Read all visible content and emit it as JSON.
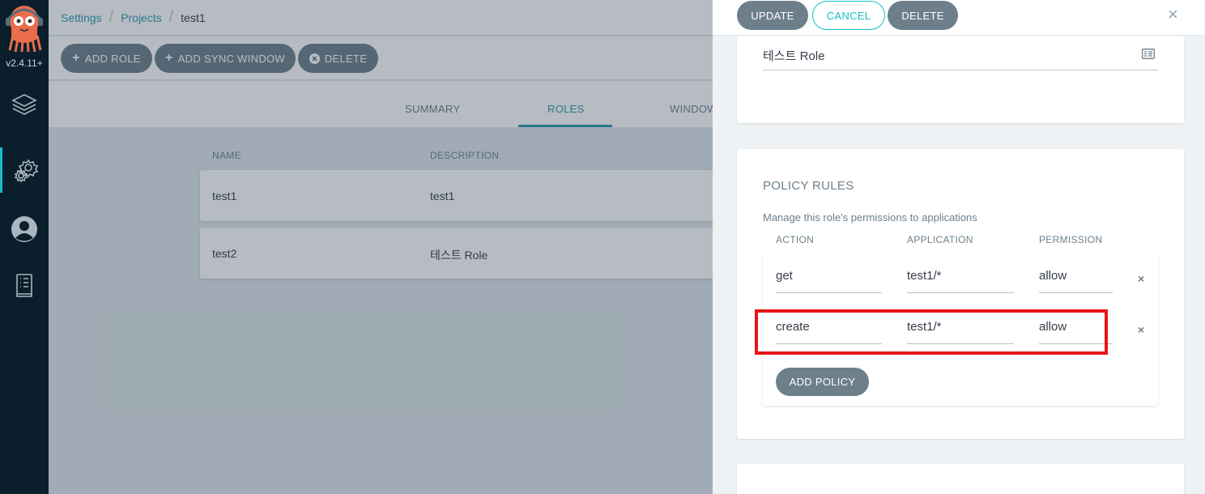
{
  "nav": {
    "version": "v2.4.11+",
    "items": [
      {
        "icon": "layers-icon"
      },
      {
        "icon": "gear-icon",
        "active": true
      },
      {
        "icon": "user-icon"
      },
      {
        "icon": "docs-icon"
      }
    ]
  },
  "breadcrumb": {
    "items": [
      "Settings",
      "Projects"
    ],
    "current": "test1"
  },
  "toolbar": {
    "add_role": "ADD ROLE",
    "add_sync_window": "ADD SYNC WINDOW",
    "delete": "DELETE"
  },
  "tabs": [
    "SUMMARY",
    "ROLES",
    "WINDOW"
  ],
  "roles_table": {
    "columns": [
      "NAME",
      "DESCRIPTION"
    ],
    "rows": [
      {
        "name": "test1",
        "description": "test1"
      },
      {
        "name": "test2",
        "description": "테스트 Role"
      }
    ]
  },
  "panel": {
    "update": "UPDATE",
    "cancel": "CANCEL",
    "delete": "DELETE",
    "close": "×",
    "description_value": "테스트 Role",
    "policy": {
      "title": "POLICY RULES",
      "subtitle": "Manage this role's permissions to applications",
      "columns": [
        "ACTION",
        "APPLICATION",
        "PERMISSION"
      ],
      "rules": [
        {
          "action": "get",
          "application": "test1/*",
          "permission": "allow"
        },
        {
          "action": "create",
          "application": "test1/*",
          "permission": "allow"
        }
      ],
      "add_policy": "ADD POLICY",
      "remove": "×"
    }
  },
  "colors": {
    "accent": "#2d9bad",
    "nav_bg": "#0b1e2c",
    "button": "#6d7f8b",
    "highlight": "#e8141a"
  }
}
